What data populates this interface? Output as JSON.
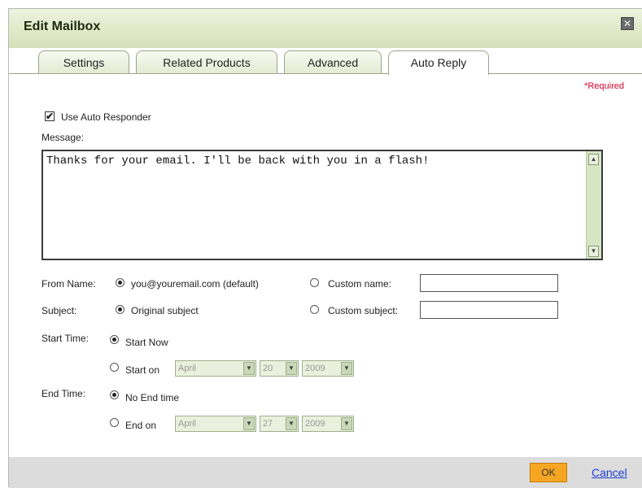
{
  "dialog": {
    "title": "Edit Mailbox",
    "close_icon": "close-icon"
  },
  "tabs": [
    {
      "label": "Settings",
      "active": false
    },
    {
      "label": "Related Products",
      "active": false
    },
    {
      "label": "Advanced",
      "active": false
    },
    {
      "label": "Auto Reply",
      "active": true
    }
  ],
  "required_note": "*Required",
  "auto_responder": {
    "label": "Use Auto Responder",
    "checked": true
  },
  "message": {
    "label": "Message:",
    "value": "Thanks for your email. I'll be back with you in a flash!"
  },
  "from_name": {
    "label": "From Name:",
    "default_option": "you@youremail.com (default)",
    "custom_option": "Custom name:",
    "custom_value": "",
    "selected": "default"
  },
  "subject": {
    "label": "Subject:",
    "original_option": "Original subject",
    "custom_option": "Custom subject:",
    "custom_value": "",
    "selected": "original"
  },
  "start_time": {
    "label": "Start Time:",
    "now_option": "Start Now",
    "on_option": "Start on",
    "selected": "now",
    "month": "April",
    "day": "20",
    "year": "2009"
  },
  "end_time": {
    "label": "End Time:",
    "none_option": "No End time",
    "on_option": "End on",
    "selected": "none",
    "month": "April",
    "day": "27",
    "year": "2009"
  },
  "footer": {
    "ok_label": "OK",
    "cancel_label": "Cancel"
  },
  "colors": {
    "header": "#dfe8c6",
    "ok_button": "#f5a623",
    "required": "#d4002a",
    "link": "#1a3fd1"
  }
}
